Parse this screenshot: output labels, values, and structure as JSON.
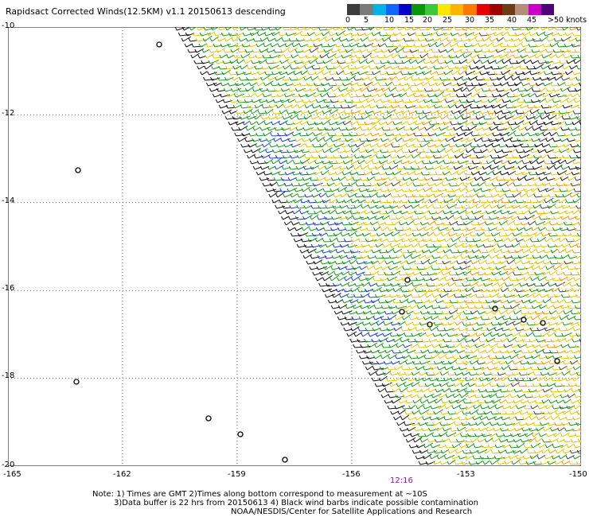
{
  "title": "Rapidsact Corrected Winds(12.5KM) v1.1 20150613 descending",
  "legend": {
    "colors": [
      "#3c3c3c",
      "#7a7a7a",
      "#00b4e6",
      "#1464ff",
      "#0000c8",
      "#0a960a",
      "#3cc83c",
      "#ffe600",
      "#ffb400",
      "#ff7800",
      "#e60000",
      "#a00000",
      "#6e3c14",
      "#b48c78",
      "#c800c8",
      "#500078"
    ],
    "labels": [
      "0",
      "5",
      "10",
      "15",
      "20",
      "25",
      "30",
      "35",
      "40",
      "45",
      ">50 knots"
    ]
  },
  "map": {
    "lat_ticks": [
      "-10",
      "-12",
      "-14",
      "-16",
      "-18",
      "-20"
    ],
    "lon_ticks": [
      "-165",
      "-162",
      "-159",
      "-156",
      "-153",
      "-150"
    ],
    "lon_range": [
      -165,
      -150
    ],
    "lat_range": [
      -10,
      -20
    ]
  },
  "pass_time": "12:16",
  "notes": [
    "Note: 1) Times are GMT 2)Times along bottom correspond to measurement at ~10S",
    "3)Data buffer is 22 hrs from 20150613 4) Black wind barbs indicate possible contamination",
    "NOAA/NESDIS/Center for Satellite Applications and Research"
  ]
}
